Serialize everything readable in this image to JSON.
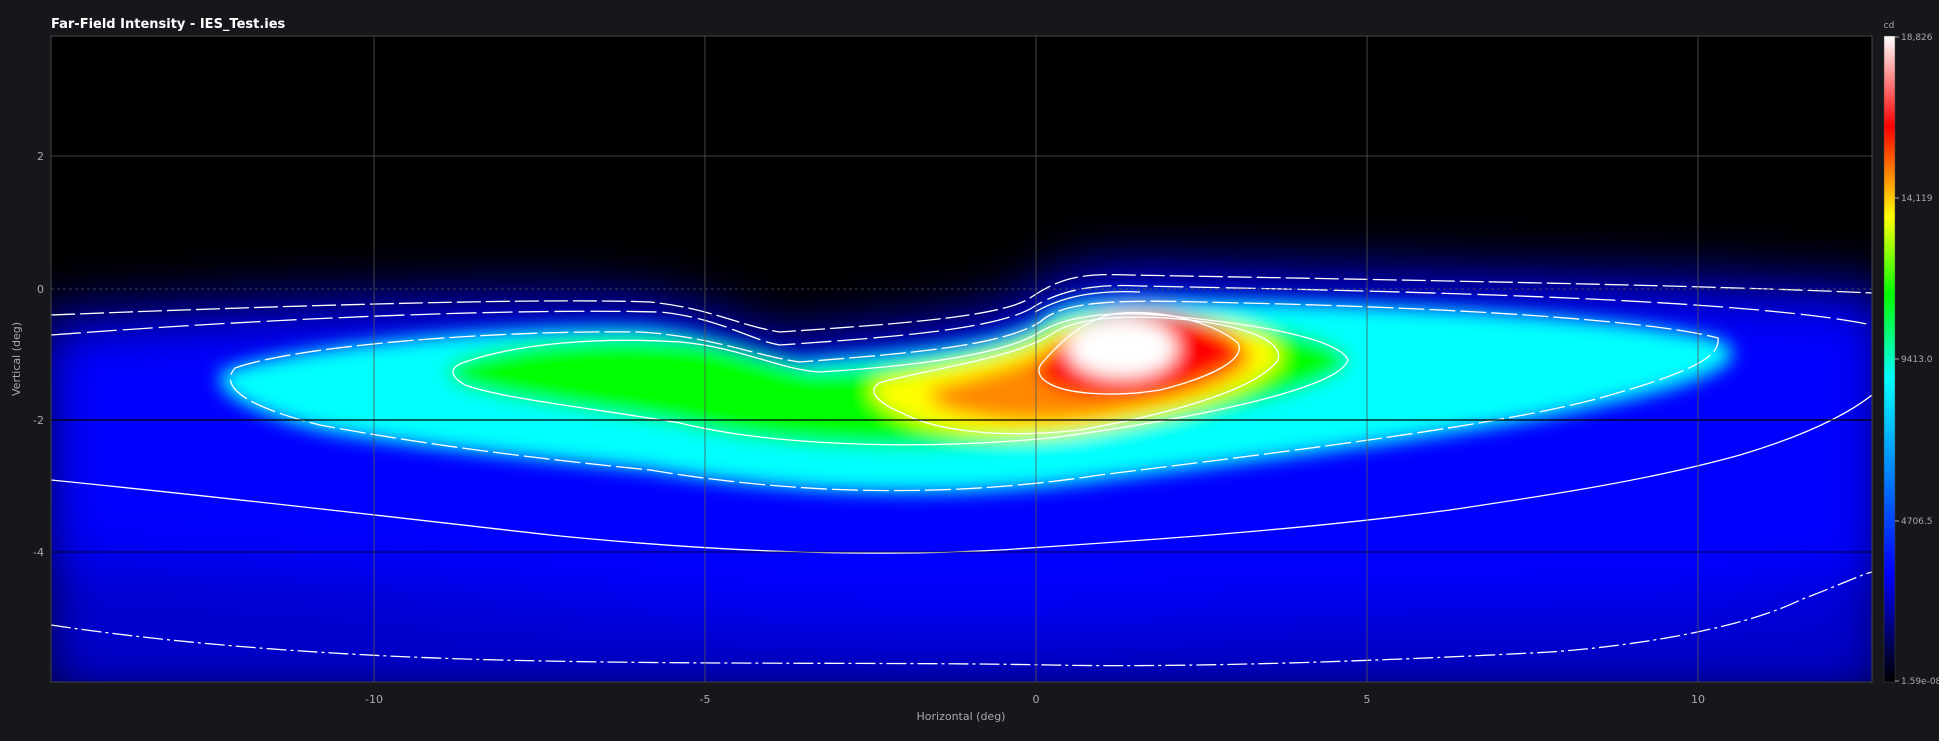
{
  "app": {
    "title": "Far-Field Intensity - IES_Test.ies"
  },
  "chart_data": {
    "type": "heatmap",
    "title": "Far-Field Intensity - IES_Test.ies",
    "xlabel": "Horizontal (deg)",
    "ylabel": "Vertical (deg)",
    "xlim": [
      -14.8,
      12.7
    ],
    "ylim": [
      -5.9,
      3.9
    ],
    "x_ticks": [
      -10,
      -5,
      0,
      5,
      10
    ],
    "y_ticks": [
      2,
      0,
      -2,
      -4
    ],
    "grid": true,
    "colormap": [
      "#000000",
      "#0000ff",
      "#00ffff",
      "#00ff00",
      "#ffff00",
      "#ff0000",
      "#ffffff"
    ],
    "colorbar": {
      "unit": "cd",
      "min": 1.59e-08,
      "max": 18826,
      "tick_labels": [
        "18,826",
        "14,119",
        "9413.0",
        "4706.5",
        "1.59e-08"
      ],
      "tick_values": [
        18826,
        14119,
        9413.0,
        4706.5,
        1.59e-08
      ]
    },
    "peak": {
      "x": 1.5,
      "y": -0.9,
      "value": 18826
    },
    "secondary_lobe": {
      "x": -6.5,
      "y": -1.2,
      "value": 10700
    },
    "contour_lines": 9
  }
}
